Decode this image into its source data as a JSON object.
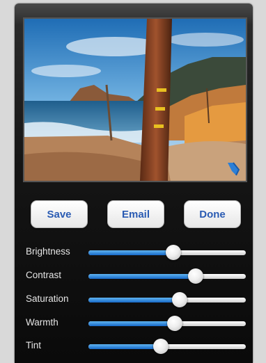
{
  "toolbar": {
    "save_label": "Save",
    "email_label": "Email",
    "done_label": "Done"
  },
  "photo": {
    "rotate_icon": "rotate-icon"
  },
  "adjustments": [
    {
      "label": "Brightness",
      "value": 0.54
    },
    {
      "label": "Contrast",
      "value": 0.68
    },
    {
      "label": "Saturation",
      "value": 0.58
    },
    {
      "label": "Warmth",
      "value": 0.55
    },
    {
      "label": "Tint",
      "value": 0.46
    }
  ],
  "colors": {
    "button_text": "#2a5bb3",
    "slider_fill": "#1769c8",
    "background": "#0a0a0a"
  }
}
